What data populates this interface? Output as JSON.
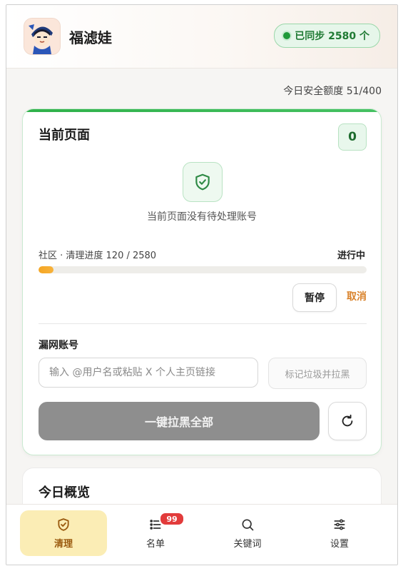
{
  "header": {
    "app_title": "福滤娃",
    "sync_badge": "已同步 2580 个"
  },
  "quota_text": "今日安全额度 51/400",
  "current_page": {
    "title": "当前页面",
    "pending_count": "0",
    "empty_message": "当前页面没有待处理账号",
    "progress_label": "社区 · 清理进度 120 / 2580",
    "progress_status": "进行中",
    "progress_done": 120,
    "progress_total": 2580,
    "pause_label": "暂停",
    "cancel_label": "取消",
    "missed_label": "漏网账号",
    "input_placeholder": "输入 @用户名或粘贴 X 个人主页链接",
    "input_value": "",
    "mark_button": "标记垃圾并拉黑",
    "block_all_button": "一键拉黑全部"
  },
  "overview": {
    "title": "今日概览"
  },
  "tabs": [
    {
      "label": "清理",
      "icon": "shield-check-icon",
      "active": true
    },
    {
      "label": "名单",
      "icon": "list-icon",
      "badge": "99"
    },
    {
      "label": "关键词",
      "icon": "search-icon"
    },
    {
      "label": "设置",
      "icon": "sliders-icon"
    }
  ],
  "colors": {
    "accent_green": "#2fb14a",
    "progress_orange": "#f5a623",
    "cancel_orange": "#d9822b",
    "active_tab_bg": "#fbedb5",
    "badge_red": "#e23b3b"
  }
}
